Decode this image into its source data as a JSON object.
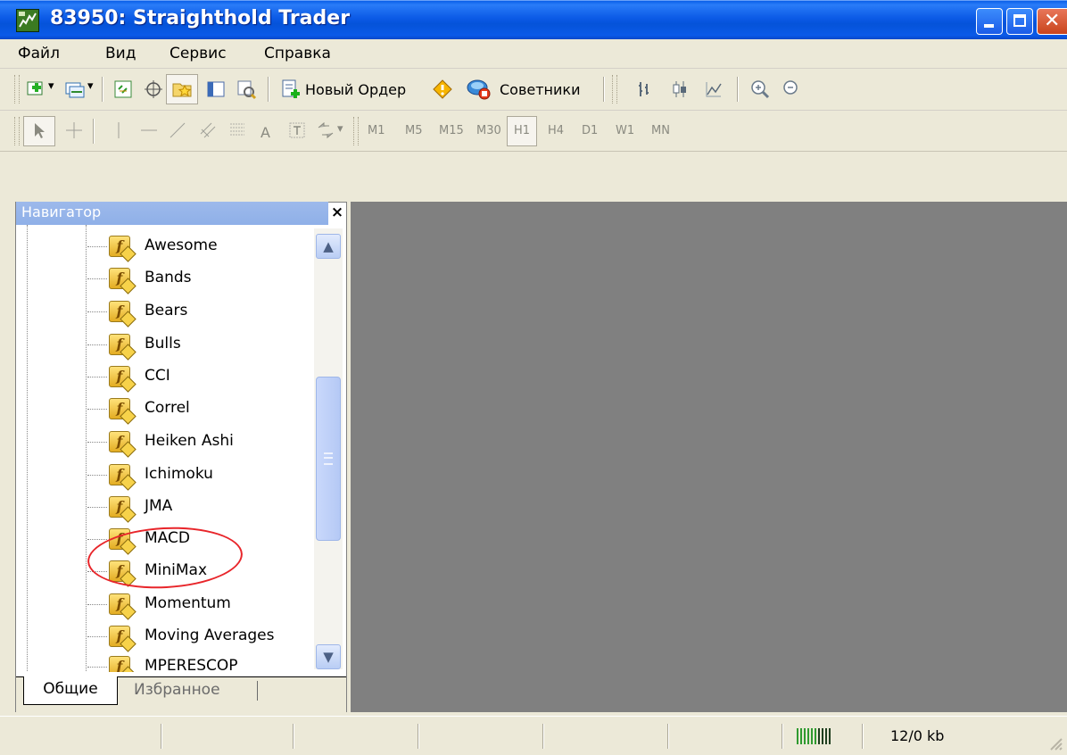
{
  "window": {
    "title": "83950: Straighthold Trader",
    "buttons": [
      "minimize",
      "maximize",
      "close"
    ]
  },
  "menu": [
    "Файл",
    "Вид",
    "Сервис",
    "Справка"
  ],
  "toolbar": {
    "new_order_label": "Новый Ордер",
    "advisors_label": "Советники"
  },
  "timeframes": [
    "M1",
    "M5",
    "M15",
    "M30",
    "H1",
    "H4",
    "D1",
    "W1",
    "MN"
  ],
  "timeframe_active": "H1",
  "navigator": {
    "title": "Навигатор",
    "close_glyph": "×",
    "items": [
      "Awesome",
      "Bands",
      "Bears",
      "Bulls",
      "CCI",
      "Correl",
      "Heiken Ashi",
      "Ichimoku",
      "JMA",
      "MACD",
      "MiniMax",
      "Momentum",
      "Moving Averages",
      "MPERESCOP"
    ],
    "highlighted": [
      "MACD",
      "MiniMax"
    ],
    "tabs": {
      "active": "Общие",
      "inactive": "Избранное"
    }
  },
  "status": {
    "traffic": "12/0 kb"
  },
  "colors": {
    "titlebar": "#0a5ae8",
    "workspace": "#808080",
    "annotation": "#e8252a"
  }
}
